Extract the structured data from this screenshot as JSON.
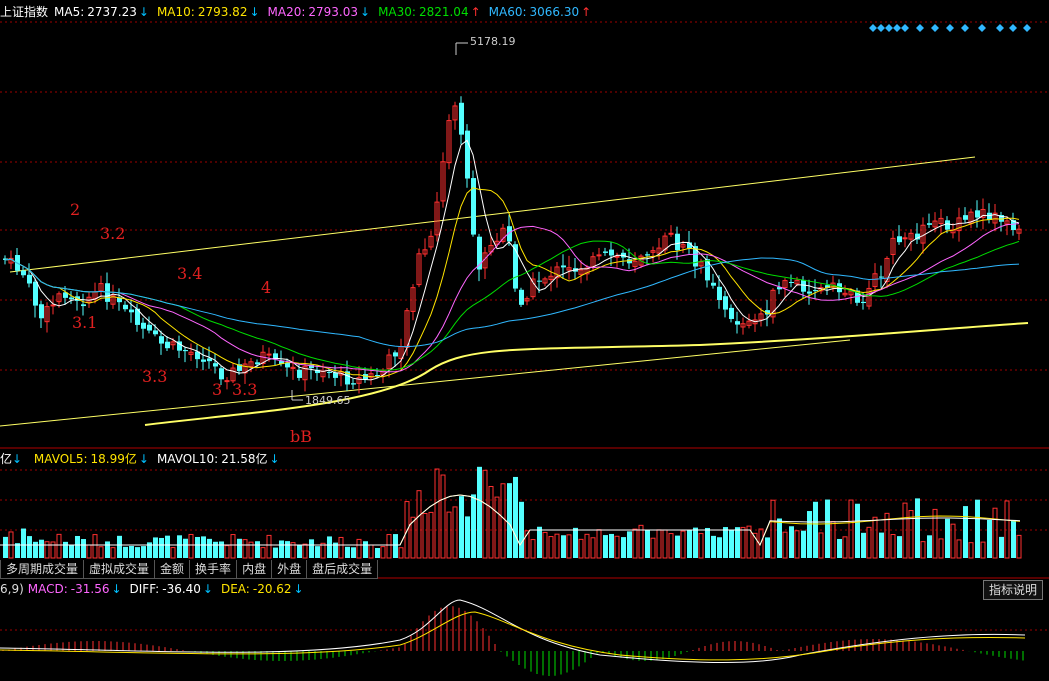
{
  "header": {
    "title": "上证指数",
    "ma": [
      {
        "label": "MA5:",
        "value": "2737.23",
        "arrow": "↓",
        "color": "#ffffff",
        "arrow_color": "#00c0ff"
      },
      {
        "label": "MA10:",
        "value": "2793.82",
        "arrow": "↓",
        "color": "#ffe400",
        "arrow_color": "#00c0ff"
      },
      {
        "label": "MA20:",
        "value": "2793.03",
        "arrow": "↓",
        "color": "#ff66ff",
        "arrow_color": "#00c0ff"
      },
      {
        "label": "MA30:",
        "value": "2821.04",
        "arrow": "↑",
        "color": "#00dd00",
        "arrow_color": "#ff3030"
      },
      {
        "label": "MA60:",
        "value": "3066.30",
        "arrow": "↑",
        "color": "#30b8ff",
        "arrow_color": "#ff3030"
      }
    ]
  },
  "volume_header": {
    "prefix": "亿",
    "items": [
      {
        "label": "MAVOL5:",
        "value": "18.99亿",
        "arrow": "↓",
        "color": "#ffe400"
      },
      {
        "label": "MAVOL10:",
        "value": "21.58亿",
        "arrow": "↓",
        "color": "#ffffff"
      }
    ]
  },
  "tabs": [
    "多周期成交量",
    "虚拟成交量",
    "金额",
    "换手率",
    "内盘",
    "外盘",
    "盘后成交量"
  ],
  "macd_header": {
    "prefix": "6,9)",
    "items": [
      {
        "label": "MACD:",
        "value": "-31.56",
        "arrow": "↓",
        "color": "#ff66ff"
      },
      {
        "label": "DIFF:",
        "value": "-36.40",
        "arrow": "↓",
        "color": "#ffffff"
      },
      {
        "label": "DEA:",
        "value": "-20.62",
        "arrow": "↓",
        "color": "#ffe400"
      }
    ],
    "help_button": "指标说明"
  },
  "price_labels": {
    "high": "5178.19",
    "low": "1849.65"
  },
  "annotations": [
    "2",
    "3.2",
    "3.4",
    "4",
    "3.1",
    "3.3",
    "3",
    "3.3",
    "bB"
  ],
  "colors": {
    "up": "#ff3030",
    "down": "#54ffff",
    "grid": "#8b0000",
    "trend": "#ffff66"
  },
  "chart_data": {
    "type": "candlestick",
    "title": "上证指数",
    "price_high": 5178.19,
    "price_low": 1849.65,
    "moving_averages": {
      "MA5": 2737.23,
      "MA10": 2793.82,
      "MA20": 2793.03,
      "MA30": 2821.04,
      "MA60": 3066.3
    },
    "volume": {
      "MAVOL5": "18.99亿",
      "MAVOL10": "21.58亿"
    },
    "macd": {
      "MACD": -31.56,
      "DIFF": -36.4,
      "DEA": -20.62
    }
  }
}
